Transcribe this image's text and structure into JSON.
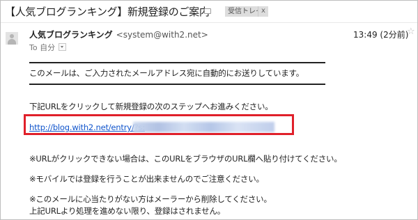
{
  "email": {
    "subject": "【人気ブログランキング】新規登録のご案内",
    "label": "受信トレイ",
    "label_close": "x",
    "sender_name": "人気ブログランキング",
    "sender_email": "<system@with2.net>",
    "recipient": "To 自分",
    "time": "13:49 (2分前)",
    "star": "☆",
    "body": {
      "notice": "このメールは、ご入力されたメールアドレス宛に自動的にお送りしています。",
      "instruction": "下記URLをクリックして新規登録の次のステップへお進みください。",
      "link": "http://blog.with2.net/entry/?s:",
      "note1": "※URLがクリックできない場合は、このURLをブラウザのURL欄へ貼り付けてください。",
      "note2": "※モバイルでは登録を行うことが出来ませんのでご注意ください。",
      "note3_line1": "※このメールに心当たりがない方はメーラーから削除してください。",
      "note3_line2": "上記URLより処理を進めない限り、登録はされません。"
    }
  },
  "colors": {
    "highlight": "#e0202a",
    "link": "#1155cc"
  }
}
